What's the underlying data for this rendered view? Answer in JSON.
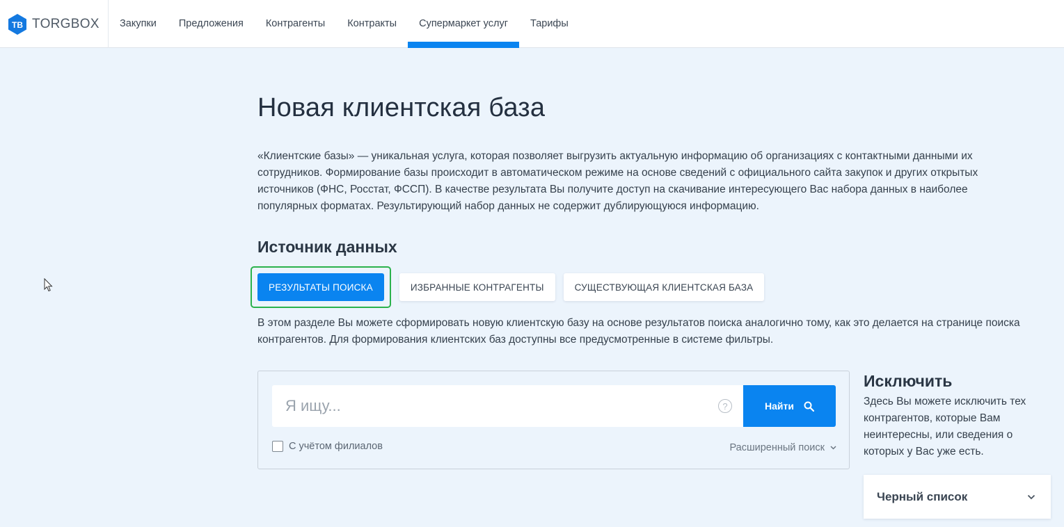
{
  "header": {
    "logo_text": "TORGBOX",
    "nav": [
      {
        "label": "Закупки",
        "active": false
      },
      {
        "label": "Предложения",
        "active": false
      },
      {
        "label": "Контрагенты",
        "active": false
      },
      {
        "label": "Контракты",
        "active": false
      },
      {
        "label": "Супермаркет услуг",
        "active": true
      },
      {
        "label": "Тарифы",
        "active": false
      }
    ]
  },
  "page": {
    "title": "Новая клиентская база",
    "intro": "«Клиентские базы» — уникальная услуга, которая позволяет выгрузить актуальную информацию об организациях с контактными данными их сотрудников. Формирование базы происходит в автоматическом режиме на основе сведений с официального сайта закупок и других открытых источников (ФНС, Росстат, ФССП). В качестве результата Вы получите доступ на скачивание интересующего Вас набора данных в наиболее популярных форматах. Результирующий набор данных не содержит дублирующуюся информацию."
  },
  "source": {
    "title": "Источник данных",
    "tabs": [
      {
        "label": "Результаты поиска",
        "active": true
      },
      {
        "label": "Избранные контрагенты",
        "active": false
      },
      {
        "label": "Существующая клиентская база",
        "active": false
      }
    ],
    "description": "В этом разделе Вы можете сформировать новую клиентскую базу на основе результатов поиска аналогично тому, как это делается на странице поиска контрагентов. Для формирования клиентских баз доступны все предусмотренные в системе фильтры."
  },
  "search": {
    "placeholder": "Я ищу...",
    "value": "",
    "help": "?",
    "button_label": "Найти",
    "branches_label": "С учётом филиалов",
    "branches_checked": false,
    "advanced_label": "Расширенный поиск"
  },
  "exclude": {
    "title": "Исключить",
    "description": "Здесь Вы можете исключить тех контрагентов, которые Вам неинтересны, или сведения о которых у Вас уже есть.",
    "blacklist_label": "Черный список"
  },
  "colors": {
    "accent": "#0a84f0",
    "focus_ring": "#2bb24c",
    "background": "#ecf4fc"
  }
}
